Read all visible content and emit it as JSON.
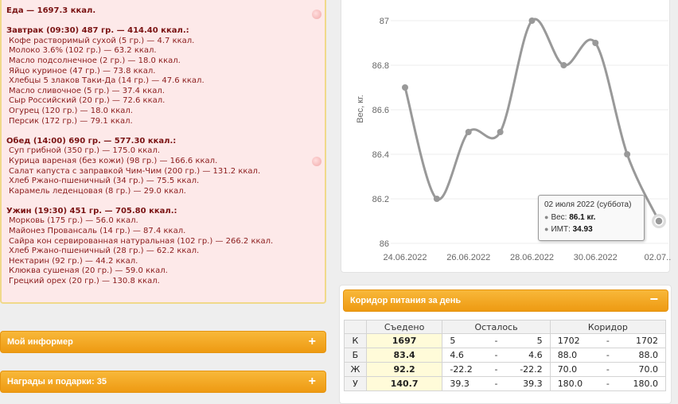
{
  "diary": {
    "total_line": "Еда — 1697.3 ккал.",
    "meals": [
      {
        "header": "Завтрак (09:30) 487 гр. — 414.40 ккал.:",
        "items": [
          "Кофе растворимый сухой (5 гр.) — 4.7 ккал.",
          "Молоко 3.6% (102 гр.) — 63.2 ккал.",
          "Масло подсолнечное (2 гр.) — 18.0 ккал.",
          "Яйцо куриное (47 гр.) — 73.8 ккал.",
          "Хлебцы 5 злаков Таки-Да (14 гр.) — 47.6 ккал.",
          "Масло сливочное (5 гр.) — 37.4 ккал.",
          "Сыр Российский (20 гр.) — 72.6 ккал.",
          "Огурец (120 гр.) — 18.0 ккал.",
          "Персик (172 гр.) — 79.1 ккал."
        ]
      },
      {
        "header": "Обед (14:00) 690 гр. — 577.30 ккал.:",
        "items": [
          "Суп грибной (350 гр.) — 175.0 ккал.",
          "Курица вареная (без кожи) (98 гр.) — 166.6 ккал.",
          "Салат капуста с заправкой Чим-Чим (200 гр.) — 131.2 ккал.",
          "Хлеб Ржано-пшеничный (34 гр.) — 75.5 ккал.",
          "Карамель леденцовая (8 гр.) — 29.0 ккал."
        ]
      },
      {
        "header": "Ужин (19:30) 451 гр. — 705.80 ккал.:",
        "items": [
          "Морковь (175 гр.) — 56.0 ккал.",
          "Майонез Провансаль (14 гр.) — 87.4 ккал.",
          "Сайра кон сервированная натуральная (102 гр.) — 266.2 ккал.",
          "Хлеб Ржано-пшеничный (28 гр.) — 62.2 ккал.",
          "Нектарин (92 гр.) — 44.2 ккал.",
          "Клюква сушеная (20 гр.) — 59.0 ккал.",
          "Грецкий орех (20 гр.) — 130.8 ккал."
        ]
      }
    ]
  },
  "panels": {
    "informer": "Мой информер",
    "awards": "Награды и подарки: 35",
    "plus_sign": "+",
    "minus_sign": "−",
    "corridor_title": "Коридор питания за день"
  },
  "chart_data": {
    "type": "line",
    "ylabel": "Вес, кг.",
    "ylim": [
      86,
      87
    ],
    "yticks": [
      "86",
      "86.2",
      "86.4",
      "86.6",
      "86.8",
      "87"
    ],
    "xticks": [
      "24.06.2022",
      "26.06.2022",
      "28.06.2022",
      "30.06.2022",
      "02.07..."
    ],
    "series": [
      {
        "values": [
          86.7,
          86.2,
          86.5,
          86.5,
          87.0,
          86.8,
          86.9,
          86.4,
          86.1
        ]
      }
    ],
    "x": [
      "24.06.2022",
      "25.06.2022",
      "26.06.2022",
      "27.06.2022",
      "28.06.2022",
      "29.06.2022",
      "30.06.2022",
      "01.07.2022",
      "02.07.2022"
    ],
    "line_color": "#999999",
    "tooltip": {
      "title": "02 июля 2022 (суббота)",
      "weight_label": "Вес:",
      "weight_value": "86.1 кг.",
      "bmi_label": "ИМТ:",
      "bmi_value": "34.93"
    }
  },
  "corridor": {
    "headers": [
      "Съедено",
      "Осталось",
      "Коридор"
    ],
    "rows": [
      {
        "key": "К",
        "eaten": "1697",
        "rem_a": "5",
        "rem_b": "5",
        "cor_a": "1702",
        "cor_b": "1702"
      },
      {
        "key": "Б",
        "eaten": "83.4",
        "rem_a": "4.6",
        "rem_b": "4.6",
        "cor_a": "88.0",
        "cor_b": "88.0"
      },
      {
        "key": "Ж",
        "eaten": "92.2",
        "rem_a": "-22.2",
        "rem_b": "-22.2",
        "cor_a": "70.0",
        "cor_b": "70.0"
      },
      {
        "key": "У",
        "eaten": "140.7",
        "rem_a": "39.3",
        "rem_b": "39.3",
        "cor_a": "180.0",
        "cor_b": "180.0"
      }
    ],
    "dash": "-"
  },
  "colors": {
    "accent_orange": "#f0a020",
    "diary_bg": "#fde9e9",
    "diary_text": "#8b1c1c"
  }
}
